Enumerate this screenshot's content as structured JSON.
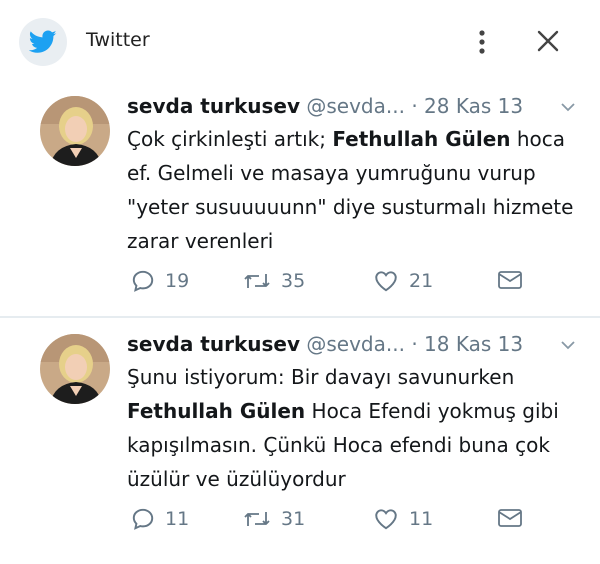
{
  "app": {
    "title": "Twitter"
  },
  "tweets": [
    {
      "user_name": "sevda turkusev",
      "handle": "@sevda...",
      "separator": "·",
      "date": "28 Kas 13",
      "text_parts": {
        "p1": "Çok çirkinleşti artık; ",
        "bold": "Fethullah Gülen",
        "p2": " hoca ef. Gelmeli ve masaya yumruğunu vurup \"yeter susuuuuunn\" diye susturmalı hizmete zarar verenleri"
      },
      "replies": "19",
      "retweets": "35",
      "likes": "21"
    },
    {
      "user_name": "sevda turkusev",
      "handle": "@sevda...",
      "separator": "·",
      "date": "18 Kas 13",
      "text_parts": {
        "p1": "Şunu istiyorum: Bir davayı savunurken ",
        "bold": "Fethullah Gülen",
        "p2": " Hoca Efendi yokmuş gibi kapışılmasın. Çünkü Hoca efendi buna çok üzülür ve üzülüyordur"
      },
      "replies": "11",
      "retweets": "31",
      "likes": "11"
    }
  ],
  "colors": {
    "brand": "#1da1f2",
    "muted": "#657786",
    "text": "#14171a",
    "divider": "#e6ecf0"
  },
  "icons": {
    "logo": "twitter-bird-icon",
    "menu": "more-vertical-icon",
    "close": "close-icon",
    "caret": "chevron-down-icon",
    "reply": "reply-icon",
    "retweet": "retweet-icon",
    "like": "heart-icon",
    "message": "message-icon"
  }
}
